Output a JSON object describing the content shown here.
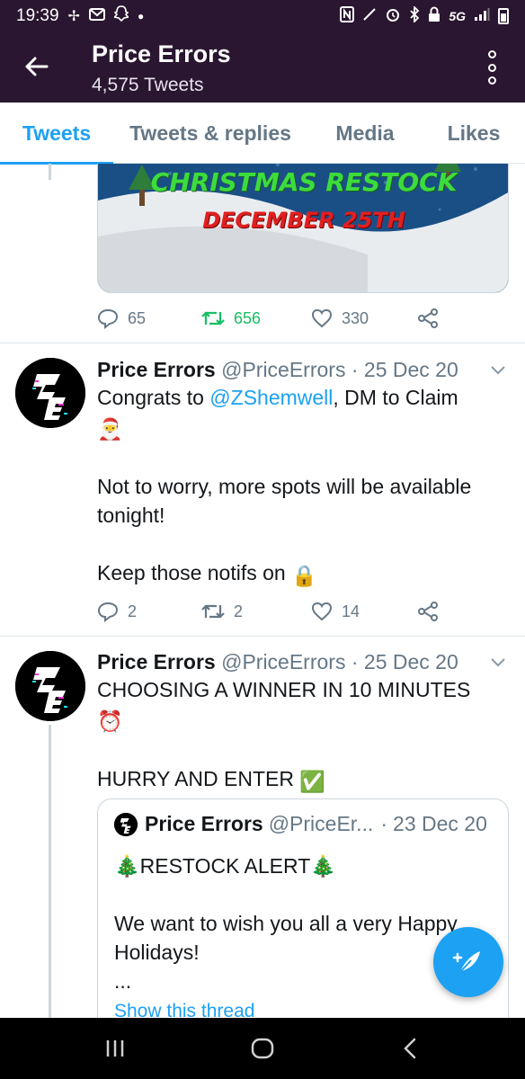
{
  "status_bar": {
    "time": "19:39",
    "network": "5G",
    "left_icons": [
      "pinwheel-icon",
      "mail-icon",
      "snapchat-icon",
      "dot-icon"
    ],
    "right_icons": [
      "nfc-icon",
      "mute-icon",
      "alarm-icon",
      "bluetooth-icon",
      "lock-icon",
      "signal-icon",
      "battery-icon"
    ]
  },
  "app_bar": {
    "title": "Price Errors",
    "subtitle": "4,575 Tweets"
  },
  "tabs": [
    {
      "label": "Tweets",
      "active": true
    },
    {
      "label": "Tweets & replies",
      "active": false
    },
    {
      "label": "Media",
      "active": false
    },
    {
      "label": "Likes",
      "active": false
    }
  ],
  "media_card": {
    "line1": "CHRISTMAS RESTOCK",
    "line2": "DECEMBER 25TH",
    "colors": {
      "sky": "#1a4f86",
      "snow": "#e9ecef",
      "green_text": "#3ddc3d",
      "red_text": "#e02020"
    }
  },
  "tweet0_actions": {
    "replies": "65",
    "retweets": "656",
    "likes": "330"
  },
  "tweets": [
    {
      "name": "Price Errors",
      "handle": "@PriceErrors",
      "sep": "·",
      "date": "25 Dec 20",
      "text_pre": "Congrats to ",
      "mention": "@ZShemwell",
      "text_post": ", DM to Claim",
      "emoji1": "🎅",
      "para2": "Not to worry, more spots will be available tonight!",
      "para3": "Keep those notifs on",
      "emoji3": "🔒",
      "replies": "2",
      "retweets": "2",
      "likes": "14"
    },
    {
      "name": "Price Errors",
      "handle": "@PriceErrors",
      "sep": "·",
      "date": "25 Dec 20",
      "line1": "CHOOSING A WINNER IN 10 MINUTES",
      "emoji1": "⏰",
      "line2": "HURRY AND ENTER",
      "emoji2": "✅",
      "quote": {
        "name": "Price Errors",
        "handle": "@PriceEr...",
        "sep": "·",
        "date": "23 Dec 20",
        "tree": "🎄",
        "title": "RESTOCK ALERT",
        "body": "We want to wish you all a very Happy Holidays!",
        "ellipsis": "...",
        "show_thread": "Show this thread"
      }
    }
  ],
  "colors": {
    "header_bg": "#2a1630",
    "accent": "#1da1f2",
    "retweet_green": "#17bf63",
    "secondary_text": "#657786"
  }
}
